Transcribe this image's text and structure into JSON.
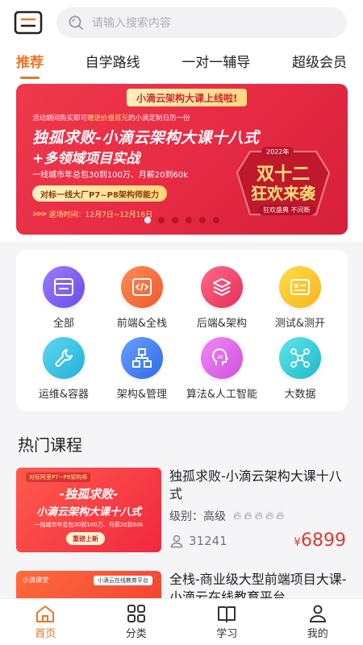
{
  "header": {
    "search_placeholder": "请输入搜索内容"
  },
  "tabs": [
    {
      "label": "推荐",
      "active": true
    },
    {
      "label": "自学路线",
      "active": false
    },
    {
      "label": "一对一辅导",
      "active": false
    },
    {
      "label": "超级会员",
      "active": false
    }
  ],
  "banner": {
    "tag": "小滴云架构大课上线啦!",
    "subtitle_pre": "活动期间购买即可",
    "subtitle_highlight": "赠送价值百元",
    "subtitle_post": "的小滴定制日历一份",
    "title_line1": "独孤求败-小滴云架构大课十八式",
    "title_line2": "+多领域项目实战",
    "salary": "一线城市年总包30到100万、月薪20到60k",
    "pill": "对标一线大厂P7~P8架构师能力",
    "time": "返场时间：12月7日~12月16日",
    "badge_year": "2022年",
    "badge_line1": "双十二",
    "badge_line2": "狂欢来袭",
    "badge_line3": "狂欢盛典 不间断",
    "dot_count": 6,
    "active_dot": 0
  },
  "categories": [
    {
      "label": "全部",
      "icon": "window-icon",
      "color": "#7a5cf0"
    },
    {
      "label": "前端&全栈",
      "icon": "code-icon",
      "color": "#f06a3a"
    },
    {
      "label": "后端&架构",
      "icon": "layers-icon",
      "color": "#ef3f6a"
    },
    {
      "label": "测试&测开",
      "icon": "test-icon",
      "color": "#f7c22e"
    },
    {
      "label": "运维&容器",
      "icon": "wrench-icon",
      "color": "#2fc2e0"
    },
    {
      "label": "架构&管理",
      "icon": "org-chart-icon",
      "color": "#3d7cf0"
    },
    {
      "label": "算法&人工智能",
      "icon": "ai-head-icon",
      "color": "#e267e8"
    },
    {
      "label": "大数据",
      "icon": "network-icon",
      "color": "#27c6d6"
    }
  ],
  "hot": {
    "title": "热门课程",
    "courses": [
      {
        "title": "独孤求败-小滴云架构大课十八式",
        "level_label": "级别：",
        "level": "高级",
        "flames": 5,
        "students": "31241",
        "price": "6899",
        "currency": "¥",
        "thumb_tag": "对标阿里P7~P8架构师",
        "thumb_line1": "-独孤求败-",
        "thumb_line2": "小滴云架构大课十八式",
        "thumb_sub": "一线城市年总包30到100万、月薪20到60k",
        "thumb_button": "重磅上新"
      },
      {
        "title": "全栈-商业级大型前端项目大课-小滴云在线教育平台",
        "thumb_brand": "小滴课堂",
        "thumb_tag": "小滴云在线教育平台"
      }
    ]
  },
  "bottom_nav": [
    {
      "label": "首页",
      "icon": "home-icon",
      "active": true
    },
    {
      "label": "分类",
      "icon": "grid-icon",
      "active": false
    },
    {
      "label": "学习",
      "icon": "book-icon",
      "active": false
    },
    {
      "label": "我的",
      "icon": "user-icon",
      "active": false
    }
  ],
  "colors": {
    "accent": "#f07422",
    "price": "#e03a2e",
    "banner": "#e62a43"
  }
}
